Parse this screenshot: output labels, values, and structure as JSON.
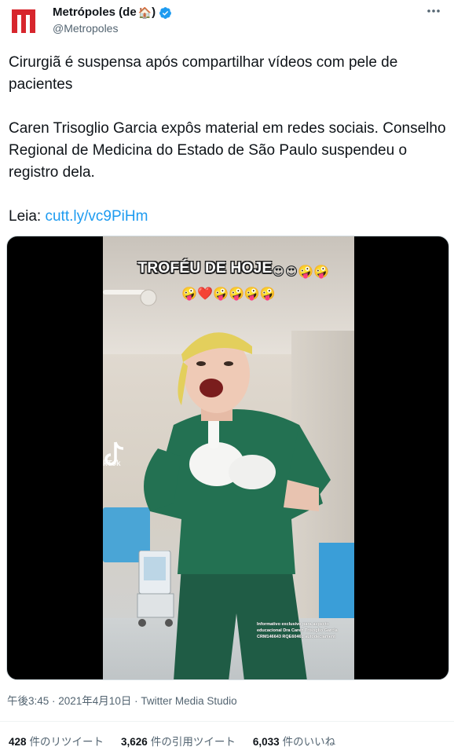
{
  "author": {
    "display_name": "Metrópoles (de",
    "display_name_suffix": ")",
    "house_emoji": "🏠",
    "handle": "@Metropoles",
    "avatar_icon": "metropoles-m-logo",
    "avatar_color": "#d7262d",
    "verified_color": "#1d9bf0"
  },
  "tweet": {
    "headline": "Cirurgiã é suspensa após compartilhar vídeos com pele de pacientes",
    "body": "Caren Trisoglio Garcia expôs material em redes sociais. Conselho Regional de Medicina do Estado de São Paulo suspendeu o registro dela.",
    "read_label": "Leia:",
    "link_text": "cutt.ly/vc9PiHm",
    "link_color": "#1d9bf0"
  },
  "video": {
    "overlay_title": "TROFÉU DE HOJE",
    "emoji_row1": "😍😍🤪🤪",
    "emoji_row2": "🤪❤️🤪🤪🤪🤪",
    "tiktok_label": "kTok",
    "watermark": "Informativo exclusivo para aspecto educacional Dra Caren Trisoglio Garcia CRM146643 RQE60461 autodeclament"
  },
  "meta": {
    "timestamp": "午後3:45 · 2021年4月10日 · Twitter Media Studio"
  },
  "stats": {
    "retweets_count": "428",
    "retweets_label": "件のリツイート",
    "quotes_count": "3,626",
    "quotes_label": "件の引用ツイート",
    "likes_count": "6,033",
    "likes_label": "件のいいね"
  }
}
